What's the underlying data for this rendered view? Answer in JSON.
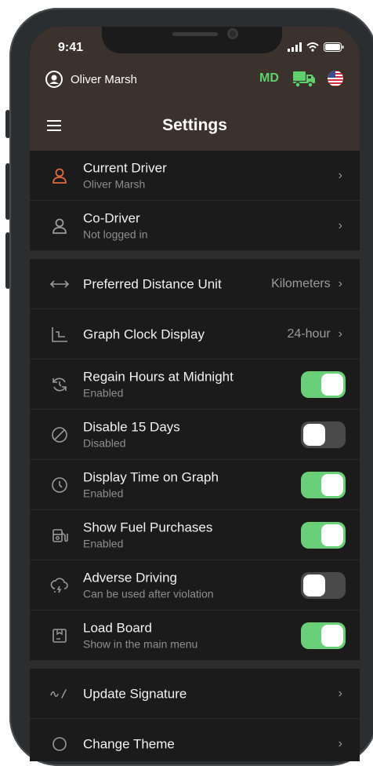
{
  "status_bar": {
    "time": "9:41"
  },
  "header": {
    "user_name": "Oliver Marsh",
    "state_badge": "MD",
    "title": "Settings"
  },
  "rows_top": [
    {
      "icon": "person-icon",
      "title": "Current Driver",
      "subtitle": "Oliver Marsh",
      "icon_color": "#e06a3d"
    },
    {
      "icon": "person-outline-icon",
      "title": "Co-Driver",
      "subtitle": "Not logged in",
      "icon_color": "#9a9a9a"
    }
  ],
  "rows_mid": [
    {
      "icon": "distance-arrows-icon",
      "title": "Preferred Distance Unit",
      "value": "Kilometers"
    },
    {
      "icon": "graph-icon",
      "title": "Graph Clock Display",
      "value": "24-hour"
    },
    {
      "icon": "midnight-refresh-icon",
      "title": "Regain Hours at Midnight",
      "subtitle": "Enabled",
      "toggle": "on"
    },
    {
      "icon": "no-symbol-icon",
      "title": "Disable 15 Days",
      "subtitle": "Disabled",
      "toggle": "off"
    },
    {
      "icon": "clock-icon",
      "title": "Display Time on Graph",
      "subtitle": "Enabled",
      "toggle": "on"
    },
    {
      "icon": "fuel-icon",
      "title": "Show Fuel Purchases",
      "subtitle": "Enabled",
      "toggle": "on"
    },
    {
      "icon": "storm-cloud-icon",
      "title": "Adverse Driving",
      "subtitle": "Can be used after violation",
      "toggle": "off"
    },
    {
      "icon": "load-box-icon",
      "title": "Load Board",
      "subtitle": "Show in the main menu",
      "toggle": "on"
    }
  ],
  "rows_bottom": [
    {
      "icon": "signature-icon",
      "title": "Update Signature"
    },
    {
      "icon": "theme-icon",
      "title": "Change Theme"
    }
  ],
  "colors": {
    "header_bg": "#3b322d",
    "screen_bg": "#1b1b1b",
    "toggle_on": "#69cf78",
    "accent_orange": "#e06a3d",
    "badge_green": "#5fd06b"
  }
}
